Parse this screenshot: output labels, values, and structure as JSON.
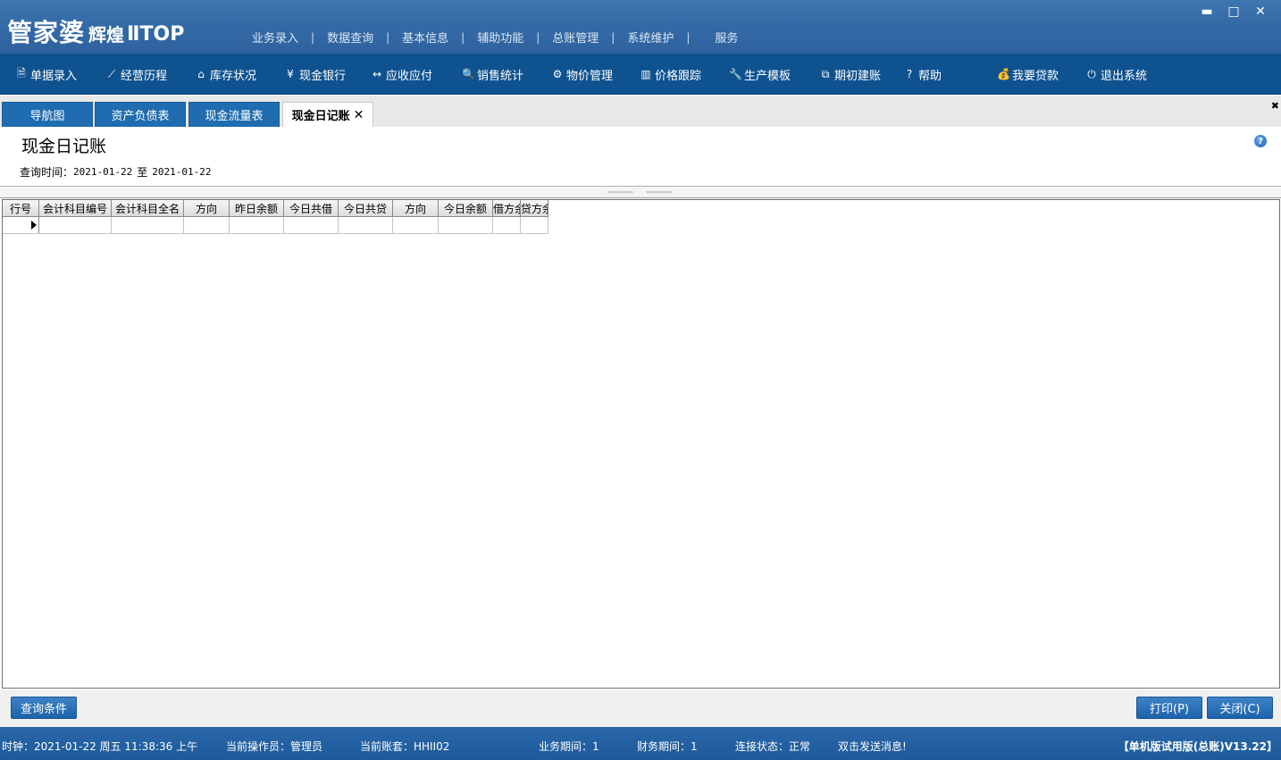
{
  "app": {
    "logo_main": "管家婆",
    "logo_edition": "辉煌",
    "logo_suffix": "ⅡTOP"
  },
  "topmenu": [
    "业务录入",
    "数据查询",
    "基本信息",
    "辅助功能",
    "总账管理",
    "系统维护",
    "服务"
  ],
  "toolbar": [
    {
      "label": "单据录入",
      "icon": "document-icon"
    },
    {
      "label": "经营历程",
      "icon": "line-chart-icon"
    },
    {
      "label": "库存状况",
      "icon": "home-icon"
    },
    {
      "label": "现金银行",
      "icon": "yen-icon"
    },
    {
      "label": "应收应付",
      "icon": "exchange-arrows-icon"
    },
    {
      "label": "销售统计",
      "icon": "magnifier-icon"
    },
    {
      "label": "物价管理",
      "icon": "gear-icon"
    },
    {
      "label": "价格跟踪",
      "icon": "bar-chart-icon"
    },
    {
      "label": "生产模板",
      "icon": "wrench-icon"
    },
    {
      "label": "期初建账",
      "icon": "external-link-icon"
    },
    {
      "label": "帮助",
      "icon": "question-icon"
    },
    {
      "label": "我要贷款",
      "icon": "money-bag-icon"
    },
    {
      "label": "退出系统",
      "icon": "power-icon"
    }
  ],
  "tabs": [
    {
      "label": "导航图",
      "active": false
    },
    {
      "label": "资产负债表",
      "active": false
    },
    {
      "label": "现金流量表",
      "active": false
    },
    {
      "label": "现金日记账",
      "active": true
    }
  ],
  "page": {
    "title": "现金日记账",
    "query_label": "查询时间：",
    "date_from": "2021-01-22",
    "date_sep": "至",
    "date_to": "2021-01-22"
  },
  "grid": {
    "columns": [
      "行号",
      "会计科目编号",
      "会计科目全名",
      "方向",
      "昨日余额",
      "今日共借",
      "今日共贷",
      "方向",
      "今日余额",
      "借方余",
      "贷方余"
    ]
  },
  "buttons": {
    "query": "查询条件",
    "print": "打印(P)",
    "close": "关闭(C)"
  },
  "status": {
    "clock": "时钟：2021-01-22 周五 11:38:36 上午",
    "operator": "当前操作员：管理员",
    "account": "当前账套：HHII02",
    "biz_period": "业务期间：1",
    "fin_period": "财务期间：1",
    "connection": "连接状态：正常",
    "message": "双击发送消息!",
    "version": "【单机版试用版(总账)V13.22】"
  },
  "colors": {
    "titlebar": "#336aa5",
    "toolbar": "#0f5290",
    "tab": "#1f6cb0",
    "statusbar": "#1d5a9c"
  }
}
